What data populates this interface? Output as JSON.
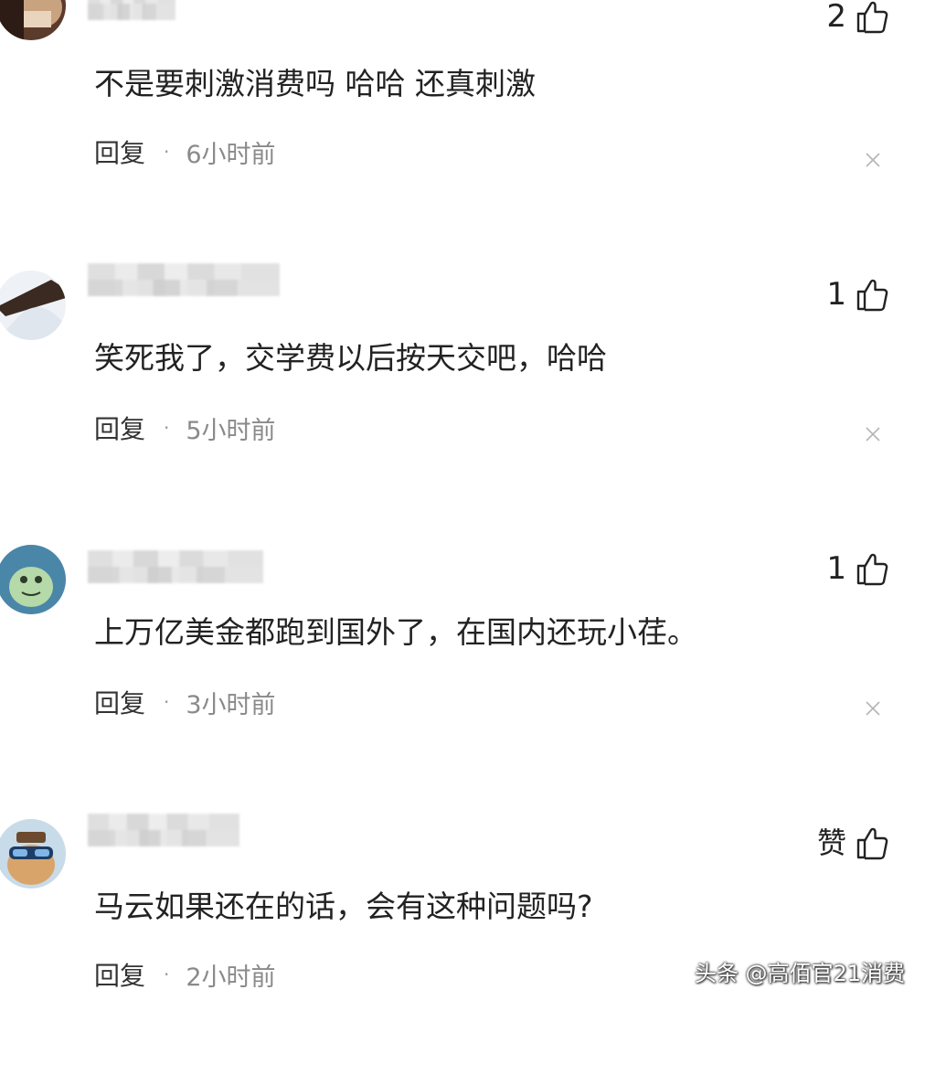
{
  "comments": [
    {
      "likes": "2",
      "text": "不是要刺激消费吗 哈哈 还真刺激",
      "reply_label": "回复",
      "separator": "·",
      "time": "6小时前",
      "avatar_icon": "avatar-dark-image",
      "close_icon": "close-icon"
    },
    {
      "likes": "1",
      "text": "笑死我了，交学费以后按天交吧，哈哈",
      "reply_label": "回复",
      "separator": "·",
      "time": "5小时前",
      "avatar_icon": "avatar-feather-image",
      "close_icon": "close-icon"
    },
    {
      "likes": "1",
      "text": "上万亿美金都跑到国外了，在国内还玩小荏。",
      "reply_label": "回复",
      "separator": "·",
      "time": "3小时前",
      "avatar_icon": "avatar-cartoon-green",
      "close_icon": "close-icon"
    },
    {
      "likes": "赞",
      "text": "马云如果还在的话，会有这种问题吗?",
      "reply_label": "回复",
      "separator": "·",
      "time": "2小时前",
      "avatar_icon": "avatar-cartoon-hamster",
      "close_icon": "close-icon"
    }
  ],
  "watermark": "头条 @高佰官21消费",
  "colors": {
    "text": "#222222",
    "meta": "#8a8a8a",
    "background": "#ffffff"
  }
}
